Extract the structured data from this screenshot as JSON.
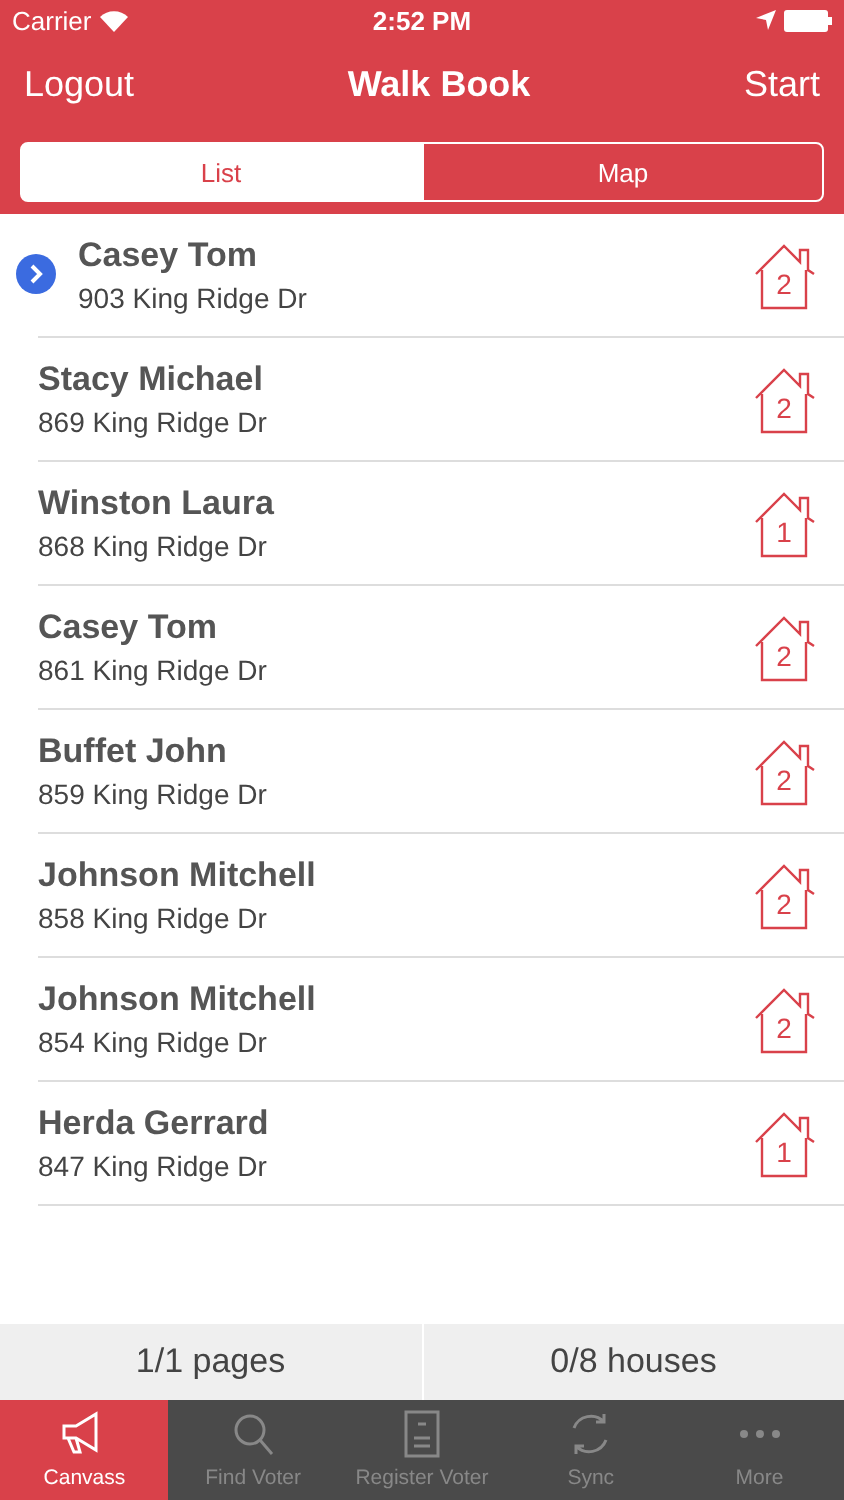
{
  "status_bar": {
    "carrier": "Carrier",
    "time": "2:52 PM"
  },
  "nav": {
    "left": "Logout",
    "title": "Walk Book",
    "right": "Start"
  },
  "segments": [
    {
      "label": "List",
      "selected": true
    },
    {
      "label": "Map",
      "selected": false
    }
  ],
  "rows": [
    {
      "name": "Casey Tom",
      "address": "903 King Ridge Dr",
      "count": "2",
      "current": true
    },
    {
      "name": "Stacy Michael",
      "address": "869 King Ridge Dr",
      "count": "2",
      "current": false
    },
    {
      "name": "Winston Laura",
      "address": "868 King Ridge Dr",
      "count": "1",
      "current": false
    },
    {
      "name": "Casey Tom",
      "address": "861 King Ridge Dr",
      "count": "2",
      "current": false
    },
    {
      "name": "Buffet John",
      "address": "859 King Ridge Dr",
      "count": "2",
      "current": false
    },
    {
      "name": "Johnson Mitchell",
      "address": "858 King Ridge Dr",
      "count": "2",
      "current": false
    },
    {
      "name": "Johnson Mitchell",
      "address": "854 King Ridge Dr",
      "count": "2",
      "current": false
    },
    {
      "name": "Herda Gerrard",
      "address": "847 King Ridge Dr",
      "count": "1",
      "current": false
    }
  ],
  "summary": {
    "pages": "1/1 pages",
    "houses": "0/8 houses"
  },
  "tabs": [
    {
      "label": "Canvass",
      "kind": "megaphone",
      "selected": true
    },
    {
      "label": "Find Voter",
      "kind": "search",
      "selected": false
    },
    {
      "label": "Register Voter",
      "kind": "form",
      "selected": false
    },
    {
      "label": "Sync",
      "kind": "sync",
      "selected": false
    },
    {
      "label": "More",
      "kind": "more",
      "selected": false
    }
  ]
}
